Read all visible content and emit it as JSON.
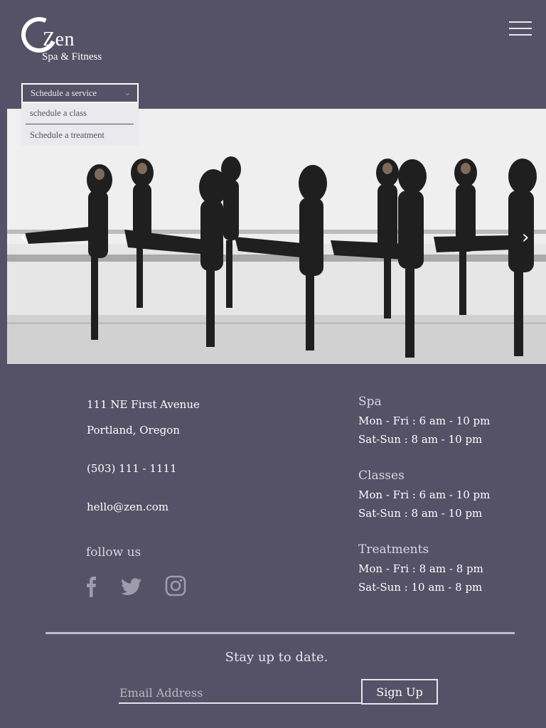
{
  "header": {
    "logo_name": "Zen",
    "logo_tagline": "Spa & Fitness",
    "menu_icon": "hamburger-icon"
  },
  "schedule_dropdown": {
    "selected": "Schedule a service",
    "options": [
      "schedule a class",
      "Schedule a treatment"
    ]
  },
  "hero": {
    "prev_arrow": "‹",
    "next_arrow": "›"
  },
  "contact": {
    "address_line1": "111 NE First Avenue",
    "address_line2": "Portland, Oregon",
    "phone": "(503) 111 - 1111",
    "email": "hello@zen.com",
    "follow_label": "follow us",
    "social_icons": [
      "facebook-icon",
      "twitter-icon",
      "instagram-icon"
    ]
  },
  "hours": [
    {
      "title": "Spa",
      "weekday": "Mon - Fri :  6 am - 10 pm",
      "weekend": "Sat-Sun : 8 am - 10 pm"
    },
    {
      "title": "Classes",
      "weekday": "Mon - Fri :  6 am - 10 pm",
      "weekend": "Sat-Sun :  8 am - 10 pm"
    },
    {
      "title": "Treatments",
      "weekday": "Mon - Fri :  8 am - 8 pm",
      "weekend": "Sat-Sun :  10 am - 8 pm"
    }
  ],
  "newsletter": {
    "heading": "Stay up to date.",
    "email_placeholder": "Email Address",
    "signup_label": "Sign Up"
  },
  "colors": {
    "background": "#555166",
    "text": "#ffffff",
    "muted": "#d9d8e0"
  }
}
